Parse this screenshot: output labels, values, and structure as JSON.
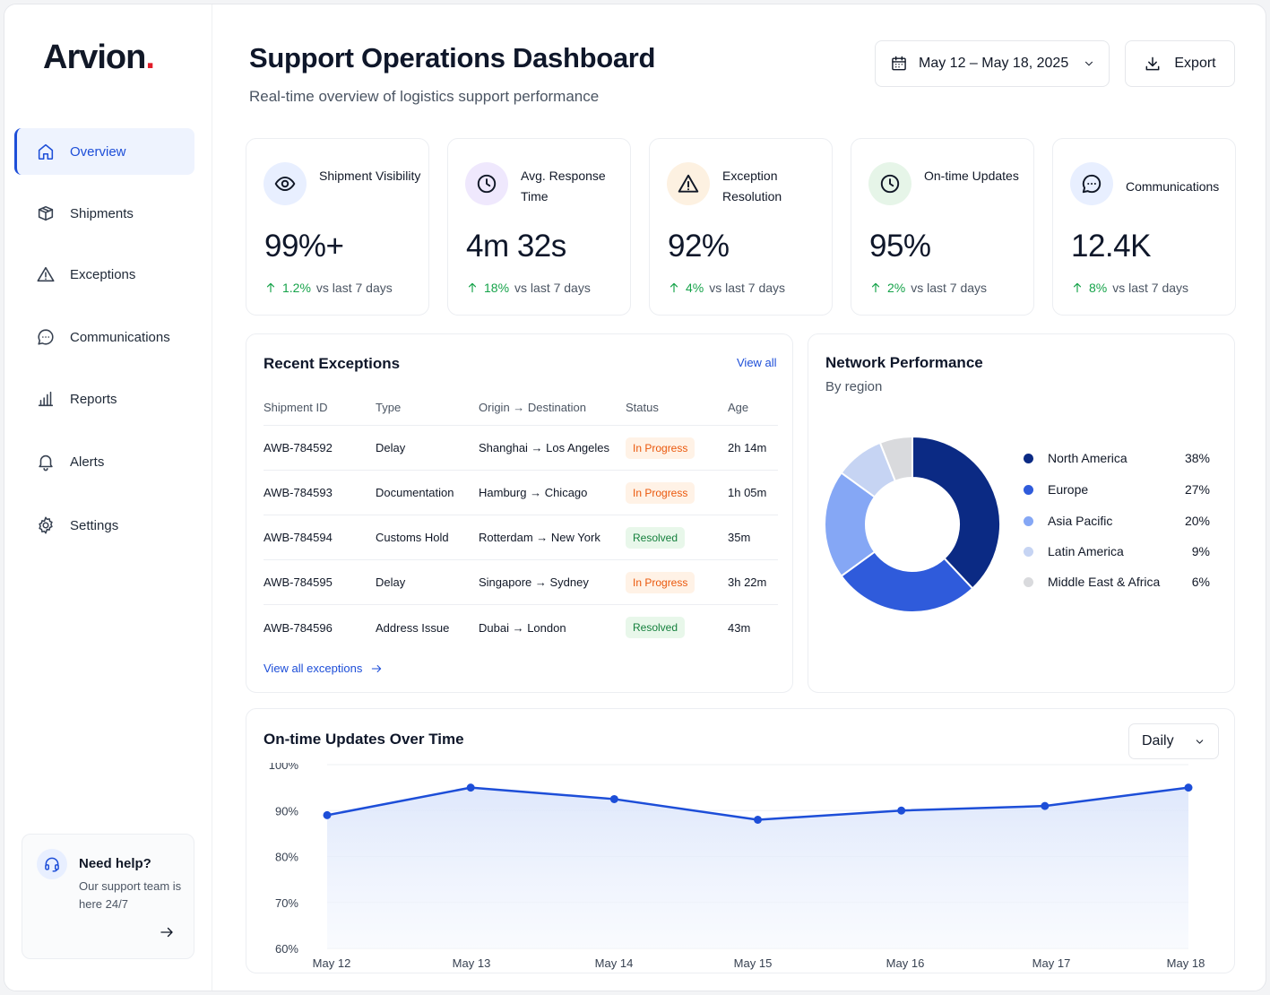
{
  "brand": {
    "name": "Arvion",
    "dot": "."
  },
  "sidebar": {
    "items": [
      {
        "label": "Overview",
        "icon": "home-icon",
        "active": true
      },
      {
        "label": "Shipments",
        "icon": "box-icon"
      },
      {
        "label": "Exceptions",
        "icon": "warning-icon"
      },
      {
        "label": "Communications",
        "icon": "chat-icon"
      },
      {
        "label": "Reports",
        "icon": "bar-chart-icon"
      },
      {
        "label": "Alerts",
        "icon": "bell-icon"
      },
      {
        "label": "Settings",
        "icon": "gear-icon"
      }
    ],
    "help": {
      "title": "Need help?",
      "text": "Our support team is here 24/7"
    }
  },
  "header": {
    "title": "Support Operations Dashboard",
    "subtitle": "Real-time overview of logistics support performance",
    "date_range": "May 12 – May 18, 2025",
    "export_label": "Export"
  },
  "kpis": [
    {
      "label": "Shipment Visibility",
      "value": "99%+",
      "delta": "1.2%",
      "delta_text": "vs last 7 days",
      "icon": "eye-icon",
      "icon_bg": "#e8efff"
    },
    {
      "label": "Avg. Response Time",
      "value": "4m 32s",
      "delta": "18%",
      "delta_text": "vs last 7 days",
      "icon": "clock-icon",
      "icon_bg": "#efe8fd"
    },
    {
      "label": "Exception Resolution",
      "value": "92%",
      "delta": "4%",
      "delta_text": "vs last 7 days",
      "icon": "warning-icon",
      "icon_bg": "#fdf1e1"
    },
    {
      "label": "On-time Updates",
      "value": "95%",
      "delta": "2%",
      "delta_text": "vs last 7 days",
      "icon": "clock-check-icon",
      "icon_bg": "#e6f5e8"
    },
    {
      "label": "Communications",
      "value": "12.4K",
      "delta": "8%",
      "delta_text": "vs last 7 days",
      "icon": "chat-icon",
      "icon_bg": "#e8efff"
    }
  ],
  "exceptions": {
    "title": "Recent Exceptions",
    "view_all": "View all",
    "columns": [
      "Shipment ID",
      "Type",
      "Origin → Destination",
      "Status",
      "Age"
    ],
    "rows": [
      {
        "id": "AWB-784592",
        "type": "Delay",
        "route": "Shanghai → Los Angeles",
        "status": "In Progress",
        "age": "2h 14m"
      },
      {
        "id": "AWB-784593",
        "type": "Documentation",
        "route": "Hamburg → Chicago",
        "status": "In Progress",
        "age": "1h 05m"
      },
      {
        "id": "AWB-784594",
        "type": "Customs Hold",
        "route": "Rotterdam → New York",
        "status": "Resolved",
        "age": "35m"
      },
      {
        "id": "AWB-784595",
        "type": "Delay",
        "route": "Singapore → Sydney",
        "status": "In Progress",
        "age": "3h 22m"
      },
      {
        "id": "AWB-784596",
        "type": "Address Issue",
        "route": "Dubai → London",
        "status": "Resolved",
        "age": "43m"
      }
    ],
    "footer_link": "View all exceptions"
  },
  "network": {
    "title": "Network Performance",
    "subtitle": "By region"
  },
  "trend": {
    "title": "On-time Updates Over Time",
    "granularity": "Daily"
  },
  "chart_data": [
    {
      "type": "pie",
      "title": "Network Performance",
      "subtitle": "By region",
      "donut": true,
      "categories": [
        "North America",
        "Europe",
        "Asia Pacific",
        "Latin America",
        "Middle East & Africa"
      ],
      "values": [
        38,
        27,
        20,
        9,
        6
      ],
      "labels": [
        "38%",
        "27%",
        "20%",
        "9%",
        "6%"
      ],
      "colors": [
        "#0b2a84",
        "#2f5bdb",
        "#85a7f5",
        "#c6d4f3",
        "#d9dadd"
      ],
      "legend": "right"
    },
    {
      "type": "area",
      "title": "On-time Updates Over Time",
      "categories": [
        "May 12",
        "May 13",
        "May 14",
        "May 15",
        "May 16",
        "May 17",
        "May 18"
      ],
      "series": [
        {
          "values": [
            89,
            95,
            92.5,
            88,
            90,
            91,
            95
          ]
        }
      ],
      "yticks": [
        "100%",
        "90%",
        "80%",
        "70%",
        "60%"
      ],
      "ylim": [
        60,
        100
      ],
      "grid": true,
      "color": "#1d4ed8"
    }
  ]
}
